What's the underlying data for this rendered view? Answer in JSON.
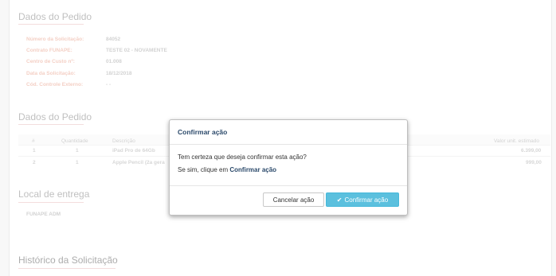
{
  "order_data": {
    "title": "Dados do Pedido",
    "fields": [
      {
        "label": "Número da Solicitação:",
        "value": "84052"
      },
      {
        "label": "Contrato FUNAPE:",
        "value": "TESTE 02 - NOVAMENTE"
      },
      {
        "label": "Centro de Custo nº:",
        "value": "01.008"
      },
      {
        "label": "Data da Solicitação:",
        "value": "18/12/2018"
      },
      {
        "label": "Cód. Controle Externo:",
        "value": "- -"
      }
    ]
  },
  "items": {
    "title": "Dados do Pedido",
    "columns": [
      "#",
      "Quantidade",
      "Descrição",
      "Valor unit. estimado"
    ],
    "rows": [
      {
        "n": "1",
        "qty": "1",
        "desc": "iPad Pro de 64Gb",
        "price": "6.399,00"
      },
      {
        "n": "2",
        "qty": "1",
        "desc": "Apple Pencil (2a gera",
        "price": "999,00"
      }
    ]
  },
  "delivery": {
    "title": "Local de entrega",
    "value": "FUNAPE ADM"
  },
  "history": {
    "title": "Histórico da Solicitação"
  },
  "modal": {
    "title": "Confirmar ação",
    "line1": "Tem certeza que deseja confirmar esta ação?",
    "line2_prefix": "Se sim, clique em",
    "line2_bold": "Confirmar ação",
    "cancel_label": "Cancelar ação",
    "confirm_label": "Confirmar ação",
    "confirm_icon": "check-icon"
  },
  "colors": {
    "accent": "#5bc0de",
    "title_blue": "#2c4a6b",
    "label_salmon": "#f2c5b8"
  }
}
